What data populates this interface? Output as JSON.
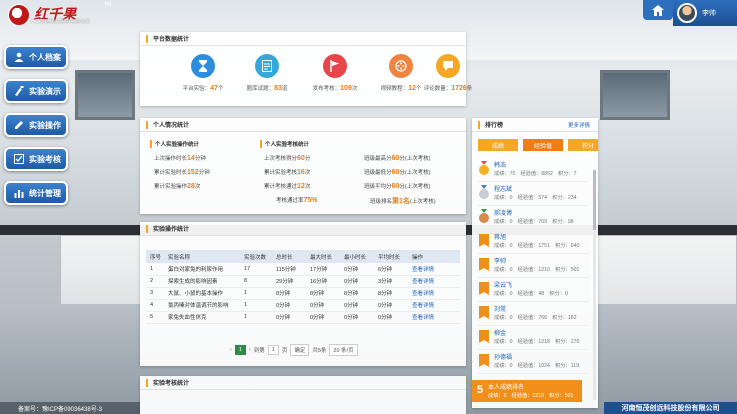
{
  "header": {
    "logo_text": "红千果",
    "logo_tm": "TM",
    "logo_subtitle": "人工智能仿真医学实验未来",
    "user_name": "李帅"
  },
  "nav": [
    {
      "label": "个人档案",
      "icon": "profile-icon"
    },
    {
      "label": "实验演示",
      "icon": "flask-icon"
    },
    {
      "label": "实验操作",
      "icon": "edit-icon"
    },
    {
      "label": "实验考核",
      "icon": "checklist-icon"
    },
    {
      "label": "统计管理",
      "icon": "chart-icon"
    }
  ],
  "platform": {
    "title": "平台数据统计",
    "stats": [
      {
        "label": "平台实验：",
        "value": "47",
        "unit": "个",
        "color": "#2d8ee0",
        "icon": "hourglass-icon"
      },
      {
        "label": "题库试题：",
        "value": "83",
        "unit": "道",
        "color": "#35a7d9",
        "icon": "document-icon"
      },
      {
        "label": "发布考核：",
        "value": "109",
        "unit": "次",
        "color": "#e8454a",
        "icon": "flag-icon"
      },
      {
        "label": "视频教程：",
        "value": "12",
        "unit": "个",
        "color": "#f0843e",
        "icon": "film-icon"
      },
      {
        "label": "评论数量：",
        "value": "1726",
        "unit": "条",
        "color": "#f5a623",
        "icon": "comment-icon"
      }
    ]
  },
  "personal": {
    "title": "个人情况统计",
    "op_title": "个人实验操作统计",
    "exam_title": "个人实验考核统计",
    "op": [
      {
        "label": "上次操作时长",
        "value": "14",
        "unit": "分钟"
      },
      {
        "label": "累计实验时长",
        "value": "152",
        "unit": "分钟"
      },
      {
        "label": "累计实验操作",
        "value": "28",
        "unit": "次"
      }
    ],
    "exam_left": [
      {
        "label": "上次考核得分",
        "value": "60",
        "unit": "分"
      },
      {
        "label": "累计实验考核",
        "value": "16",
        "unit": "次"
      },
      {
        "label": "累计考核通过",
        "value": "12",
        "unit": "次"
      },
      {
        "label": "考核通过率",
        "value": "75%",
        "unit": ""
      }
    ],
    "exam_right": [
      {
        "label": "班级最高分",
        "value": "60",
        "unit": "分(上次考核)"
      },
      {
        "label": "班级最低分",
        "value": "60",
        "unit": "分(上次考核)"
      },
      {
        "label": "班级平均分",
        "value": "60",
        "unit": "分(上次考核)"
      },
      {
        "label": "班级排名",
        "value": "第1名",
        "unit": "(上次考核)"
      }
    ]
  },
  "operation": {
    "title": "实验操作统计",
    "columns": [
      "序号",
      "实验名称",
      "实验次数",
      "总时长",
      "最大时长",
      "最小时长",
      "平均时长",
      "操作"
    ],
    "rows": [
      [
        "1",
        "蛋白对家兔的利尿作用",
        "17",
        "115分钟",
        "17分钟",
        "0分钟",
        "6分钟",
        "查看详情"
      ],
      [
        "2",
        "探索生成的影响因素",
        "8",
        "29分钟",
        "16分钟",
        "0分钟",
        "3分钟",
        "查看详情"
      ],
      [
        "3",
        "大鼠、小鼠的基本操作",
        "1",
        "8分钟",
        "8分钟",
        "8分钟",
        "8分钟",
        "查看详情"
      ],
      [
        "4",
        "氯丙嗪对体温调节的影响",
        "1",
        "0分钟",
        "0分钟",
        "0分钟",
        "0分钟",
        "查看详情"
      ],
      [
        "5",
        "家兔失血性休克",
        "1",
        "0分钟",
        "0分钟",
        "0分钟",
        "0分钟",
        "查看详情"
      ]
    ],
    "pager": {
      "current": "1",
      "goto": "到第",
      "page": "1",
      "unit": "页",
      "confirm": "确定",
      "total": "共5条",
      "per_page": "20 条/页"
    }
  },
  "exam": {
    "title": "实验考核统计"
  },
  "ranking": {
    "title": "排行榜",
    "more": "更多详情",
    "tabs": [
      {
        "label": "成绩",
        "color": "#f5a623"
      },
      {
        "label": "经验值",
        "color": "#f07c12"
      },
      {
        "label": "积分",
        "color": "#f5a623"
      }
    ],
    "items": [
      {
        "name": "韩浩",
        "score": "成绩：70",
        "exp": "经验值：8862",
        "points": "积分：7"
      },
      {
        "name": "程志斌",
        "score": "成绩：0",
        "exp": "经验值：574",
        "points": "积分：234"
      },
      {
        "name": "郝凌博",
        "score": "成绩：0",
        "exp": "经验值：709",
        "points": "积分：98"
      },
      {
        "name": "蒋旭",
        "score": "成绩：0",
        "exp": "经验值：1751",
        "points": "积分：640"
      },
      {
        "name": "李帅",
        "score": "成绩：0",
        "exp": "经验值：1210",
        "points": "积分：501"
      },
      {
        "name": "梁云飞",
        "score": "成绩：0",
        "exp": "经验值：48",
        "points": "积分：0"
      },
      {
        "name": "刘常",
        "score": "成绩：0",
        "exp": "经验值：766",
        "points": "积分：182"
      },
      {
        "name": "柳金",
        "score": "成绩：0",
        "exp": "经验值：1218",
        "points": "积分：270"
      },
      {
        "name": "孙德福",
        "score": "成绩：0",
        "exp": "经验值：1024",
        "points": "积分：119"
      }
    ],
    "me": {
      "rank": "5",
      "title": "本人成绩排名",
      "score": "成绩：0",
      "exp": "经验值：1210",
      "points": "积分：501"
    }
  },
  "footer": {
    "icp": "备案号：豫ICP备09036438号-3",
    "company": "河南恒茂创远科技股份有限公司"
  }
}
